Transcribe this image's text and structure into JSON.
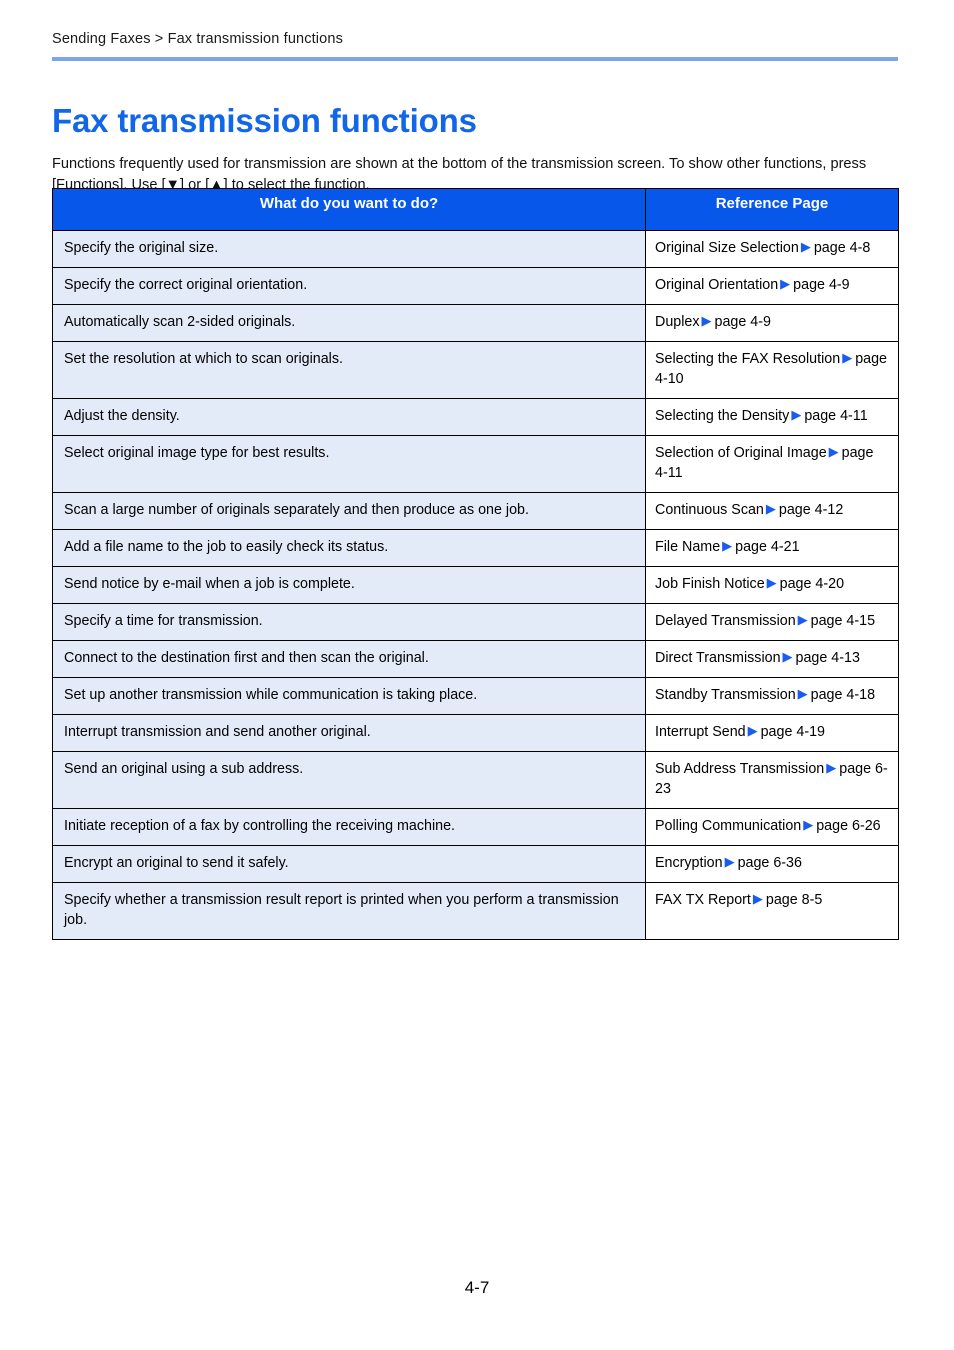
{
  "breadcrumb": "Sending Faxes > Fax transmission functions",
  "page_title": "Fax transmission functions",
  "intro": "Functions frequently used for transmission are shown at the bottom of the transmission screen. To show other functions, press [Functions]. Use [▼] or [▲] to select the function.",
  "colors": {
    "title_blue": "#1266e8",
    "rule_blue": "#7aa7ec",
    "header_blue": "#0757ea",
    "row_blue": "#e4ebf8",
    "arrow_blue": "#1a5cf0"
  },
  "table": {
    "headers": {
      "task": "What do you want to do?",
      "reference": "Reference Page"
    },
    "arrow_glyph": "▶",
    "rows": [
      {
        "task": "Specify the original size.",
        "ref_name": "Original Size Selection",
        "ref_page": "page 4-8"
      },
      {
        "task": "Specify the correct original orientation.",
        "ref_name": "Original Orientation",
        "ref_page": "page 4-9"
      },
      {
        "task": "Automatically scan 2-sided originals.",
        "ref_name": "Duplex",
        "ref_page": "page 4-9"
      },
      {
        "task": "Set the resolution at which to scan originals.",
        "ref_name": "Selecting the FAX Resolution",
        "ref_page": "page 4-10"
      },
      {
        "task": "Adjust the density.",
        "ref_name": "Selecting the Density",
        "ref_page": "page 4-11"
      },
      {
        "task": "Select original image type for best results.",
        "ref_name": "Selection of Original Image",
        "ref_page": "page 4-11"
      },
      {
        "task": "Scan a large number of originals separately and then produce as one job.",
        "ref_name": "Continuous Scan",
        "ref_page": "page 4-12"
      },
      {
        "task": "Add a file name to the job to easily check its status.",
        "ref_name": "File Name",
        "ref_page": "page 4-21"
      },
      {
        "task": "Send notice by e-mail when a job is complete.",
        "ref_name": "Job Finish Notice",
        "ref_page": "page 4-20"
      },
      {
        "task": "Specify a time for transmission.",
        "ref_name": "Delayed Transmission",
        "ref_page": "page 4-15"
      },
      {
        "task": "Connect to the destination first and then scan the original.",
        "ref_name": "Direct Transmission",
        "ref_page": "page 4-13"
      },
      {
        "task": "Set up another transmission while communication is taking place.",
        "ref_name": "Standby Transmission",
        "ref_page": "page 4-18"
      },
      {
        "task": "Interrupt transmission and send another original.",
        "ref_name": "Interrupt Send",
        "ref_page": "page 4-19"
      },
      {
        "task": "Send an original using a sub address.",
        "ref_name": "Sub Address Transmission",
        "ref_page": "page 6-23"
      },
      {
        "task": "Initiate reception of a fax by controlling the receiving machine.",
        "ref_name": "Polling Communication",
        "ref_page": "page 6-26"
      },
      {
        "task": "Encrypt an original to send it safely.",
        "ref_name": "Encryption",
        "ref_page": "page 6-36"
      },
      {
        "task": "Specify whether a transmission result report is printed when you perform a transmission job.",
        "ref_name": "FAX TX Report",
        "ref_page": "page 8-5"
      }
    ]
  },
  "footer": {
    "page_number": "4-7"
  }
}
